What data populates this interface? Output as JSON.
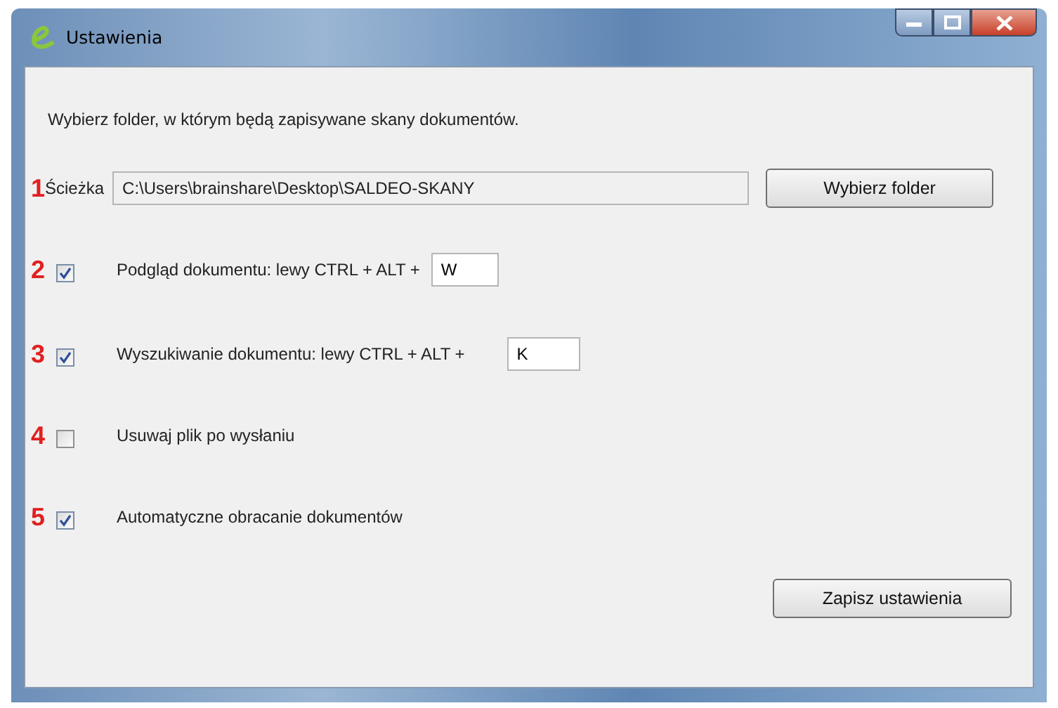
{
  "window": {
    "title": "Ustawienia"
  },
  "instruction": "Wybierz folder, w którym będą zapisywane skany dokumentów.",
  "path_row": {
    "marker": "1",
    "label": "Ścieżka",
    "value": "C:\\Users\\brainshare\\Desktop\\SALDEO-SKANY",
    "button": "Wybierz folder"
  },
  "options": [
    {
      "marker": "2",
      "checked": true,
      "label": "Podgląd dokumentu: lewy CTRL + ALT +",
      "key": "W"
    },
    {
      "marker": "3",
      "checked": true,
      "label": "Wyszukiwanie dokumentu: lewy CTRL + ALT +",
      "key": "K"
    },
    {
      "marker": "4",
      "checked": false,
      "label": "Usuwaj plik po wysłaniu"
    },
    {
      "marker": "5",
      "checked": true,
      "label": "Automatyczne obracanie dokumentów"
    }
  ],
  "save_button": "Zapisz ustawienia"
}
